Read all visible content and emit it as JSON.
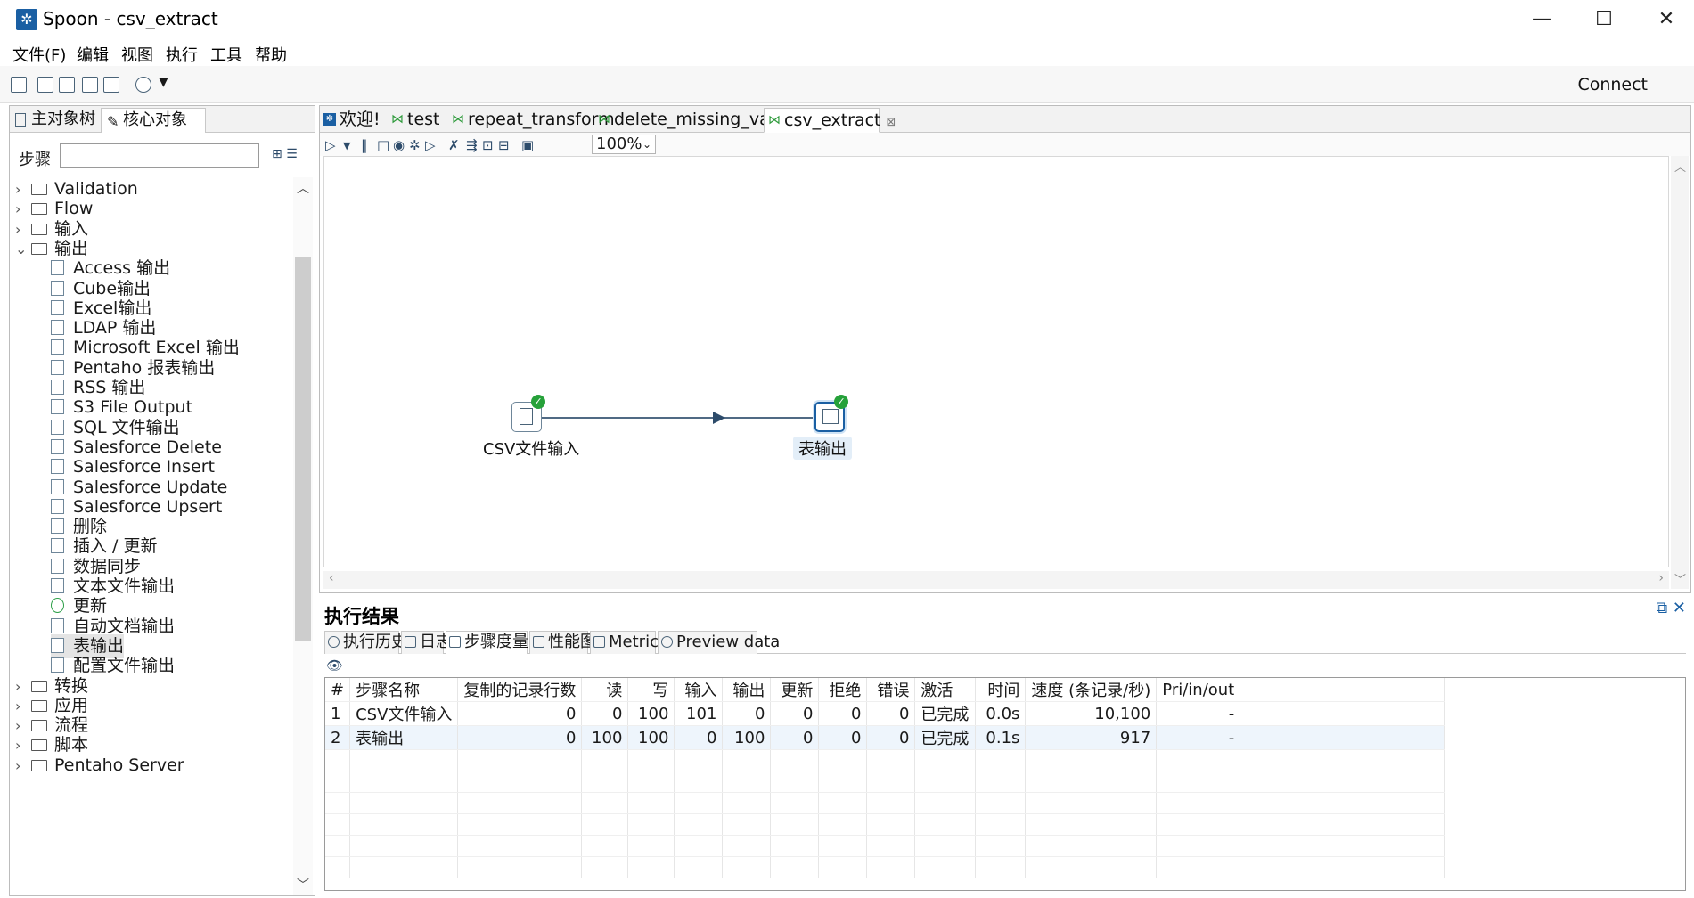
{
  "window": {
    "title": "Spoon - csv_extract",
    "minimize": "—",
    "maximize": "☐",
    "close": "✕"
  },
  "menu": [
    "文件(F)",
    "编辑",
    "视图",
    "执行",
    "工具",
    "帮助"
  ],
  "toolbar": {
    "connect": "Connect"
  },
  "left_panel": {
    "tabs": [
      "主对象树",
      "核心对象"
    ],
    "search_label": "步骤",
    "search_value": "",
    "tree": [
      {
        "label": "Validation",
        "type": "folder",
        "expanded": false
      },
      {
        "label": "Flow",
        "type": "folder",
        "expanded": false
      },
      {
        "label": "输入",
        "type": "folder",
        "expanded": false
      },
      {
        "label": "输出",
        "type": "folder",
        "expanded": true
      },
      {
        "label": "Access 输出",
        "type": "leaf"
      },
      {
        "label": "Cube输出",
        "type": "leaf"
      },
      {
        "label": "Excel输出",
        "type": "leaf"
      },
      {
        "label": "LDAP 输出",
        "type": "leaf"
      },
      {
        "label": "Microsoft Excel 输出",
        "type": "leaf"
      },
      {
        "label": "Pentaho 报表输出",
        "type": "leaf"
      },
      {
        "label": "RSS 输出",
        "type": "leaf"
      },
      {
        "label": "S3 File Output",
        "type": "leaf"
      },
      {
        "label": "SQL 文件输出",
        "type": "leaf"
      },
      {
        "label": "Salesforce Delete",
        "type": "leaf"
      },
      {
        "label": "Salesforce Insert",
        "type": "leaf"
      },
      {
        "label": "Salesforce Update",
        "type": "leaf"
      },
      {
        "label": "Salesforce Upsert",
        "type": "leaf"
      },
      {
        "label": "删除",
        "type": "leaf"
      },
      {
        "label": "插入 / 更新",
        "type": "leaf"
      },
      {
        "label": "数据同步",
        "type": "leaf"
      },
      {
        "label": "文本文件输出",
        "type": "leaf"
      },
      {
        "label": "更新",
        "type": "leaf",
        "icon": "refresh"
      },
      {
        "label": "自动文档输出",
        "type": "leaf"
      },
      {
        "label": "表输出",
        "type": "leaf",
        "selected": true
      },
      {
        "label": "配置文件输出",
        "type": "leaf"
      },
      {
        "label": "转换",
        "type": "folder",
        "expanded": false
      },
      {
        "label": "应用",
        "type": "folder",
        "expanded": false
      },
      {
        "label": "流程",
        "type": "folder",
        "expanded": false
      },
      {
        "label": "脚本",
        "type": "folder",
        "expanded": false
      },
      {
        "label": "Pentaho Server",
        "type": "folder",
        "expanded": false
      }
    ]
  },
  "editor": {
    "tabs": [
      {
        "label": "欢迎!",
        "icon": "spoon-icon"
      },
      {
        "label": "test",
        "icon": "transform-icon"
      },
      {
        "label": "repeat_transform",
        "icon": "transform-icon"
      },
      {
        "label": "delete_missing_value",
        "icon": "transform-icon"
      },
      {
        "label": "csv_extract",
        "icon": "transform-icon",
        "active": true
      }
    ],
    "zoom": "100%",
    "steps": [
      {
        "label": "CSV文件输入",
        "status": "ok"
      },
      {
        "label": "表输出",
        "status": "ok",
        "selected": true
      }
    ]
  },
  "results": {
    "title": "执行结果",
    "tabs": [
      "执行历史",
      "日志",
      "步骤度量",
      "性能图",
      "Metrics",
      "Preview data"
    ],
    "active_tab": "步骤度量",
    "columns": [
      "#",
      "步骤名称",
      "复制的记录行数",
      "读",
      "写",
      "输入",
      "输出",
      "更新",
      "拒绝",
      "错误",
      "激活",
      "时间",
      "速度 (条记录/秒)",
      "Pri/in/out"
    ],
    "rows": [
      [
        "1",
        "CSV文件输入",
        "0",
        "0",
        "100",
        "101",
        "0",
        "0",
        "0",
        "0",
        "已完成",
        "0.0s",
        "10,100",
        "-"
      ],
      [
        "2",
        "表输出",
        "0",
        "100",
        "100",
        "0",
        "100",
        "0",
        "0",
        "0",
        "已完成",
        "0.1s",
        "917",
        "-"
      ]
    ]
  }
}
